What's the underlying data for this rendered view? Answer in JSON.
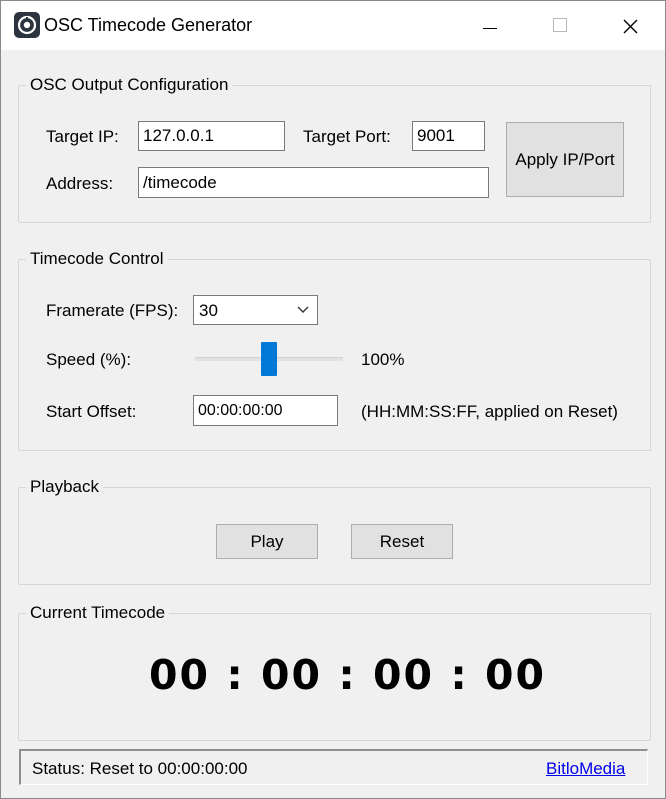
{
  "window": {
    "title": "OSC Timecode Generator",
    "icon": "app-logo-icon",
    "controls": {
      "minimize": "minimize-icon",
      "maximize": "maximize-icon",
      "close": "close-icon"
    }
  },
  "osc": {
    "legend": "OSC Output Configuration",
    "ip_label": "Target IP:",
    "ip_value": "127.0.0.1",
    "port_label": "Target Port:",
    "port_value": "9001",
    "address_label": "Address:",
    "address_value": "/timecode",
    "apply_label": "Apply IP/Port"
  },
  "control": {
    "legend": "Timecode Control",
    "fps_label": "Framerate (FPS):",
    "fps_value": "30",
    "speed_label": "Speed (%):",
    "speed_value": "100%",
    "speed_level": 0.5,
    "offset_label": "Start Offset:",
    "offset_value": "00:00:00:00",
    "offset_hint": "(HH:MM:SS:FF, applied on Reset)"
  },
  "playback": {
    "legend": "Playback",
    "play_label": "Play",
    "reset_label": "Reset"
  },
  "current": {
    "legend": "Current Timecode",
    "timecode": "00 : 00 : 00 : 00"
  },
  "statusbar": {
    "status": "Status: Reset to 00:00:00:00",
    "link": "BitloMedia"
  },
  "colors": {
    "accent": "#0078d7",
    "window_bg": "#f0f0f0",
    "link": "#0000ee"
  }
}
